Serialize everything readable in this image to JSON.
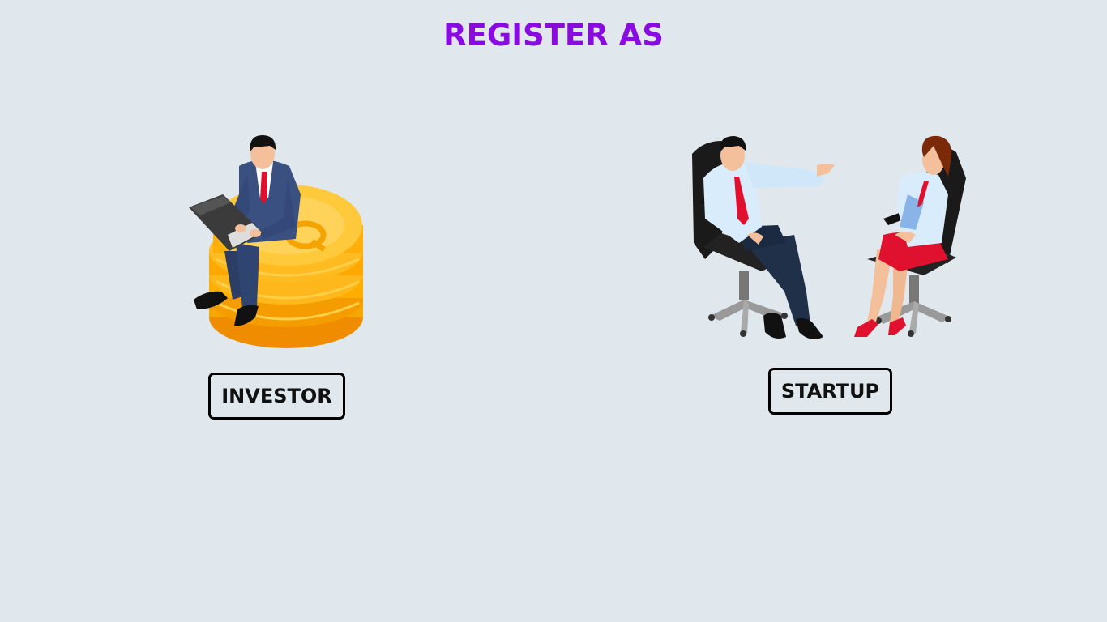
{
  "header": {
    "title": "REGISTER AS"
  },
  "options": {
    "investor": {
      "label": "INVESTOR",
      "illustration": "investor-on-coins-illustration"
    },
    "startup": {
      "label": "STARTUP",
      "illustration": "startup-meeting-illustration"
    }
  },
  "colors": {
    "background": "#e0e8ed",
    "title": "#8a0be0",
    "button_border": "#000000"
  }
}
